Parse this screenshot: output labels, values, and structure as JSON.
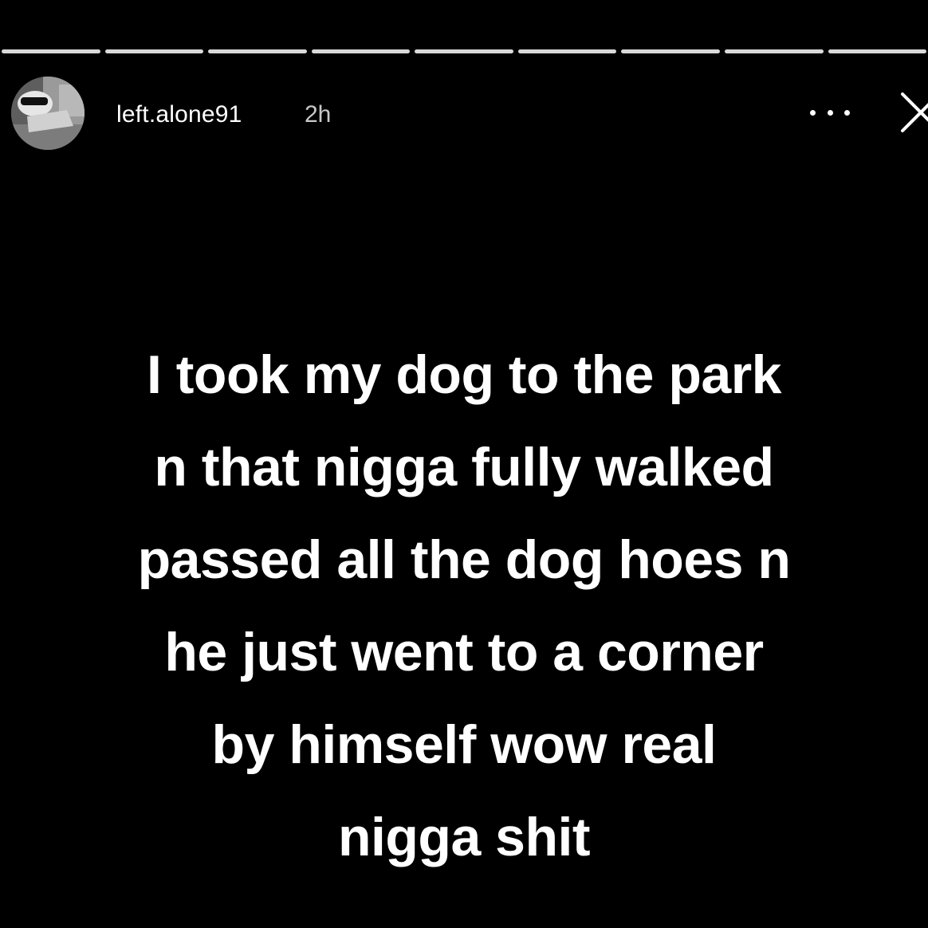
{
  "story": {
    "progress_segments": 9,
    "header": {
      "username": "left.alone91",
      "timestamp": "2h",
      "more_icon": "more-horizontal-icon",
      "close_icon": "close-icon"
    },
    "message_lines": [
      "I took my dog to the park",
      "n that nigga fully walked",
      "passed all the dog hoes n",
      "he just went to a corner",
      "by himself wow real",
      "nigga shit"
    ]
  },
  "colors": {
    "background": "#000000",
    "text": "#ffffff",
    "timestamp": "#c8c8c8",
    "progress": "#d9d9d9"
  }
}
